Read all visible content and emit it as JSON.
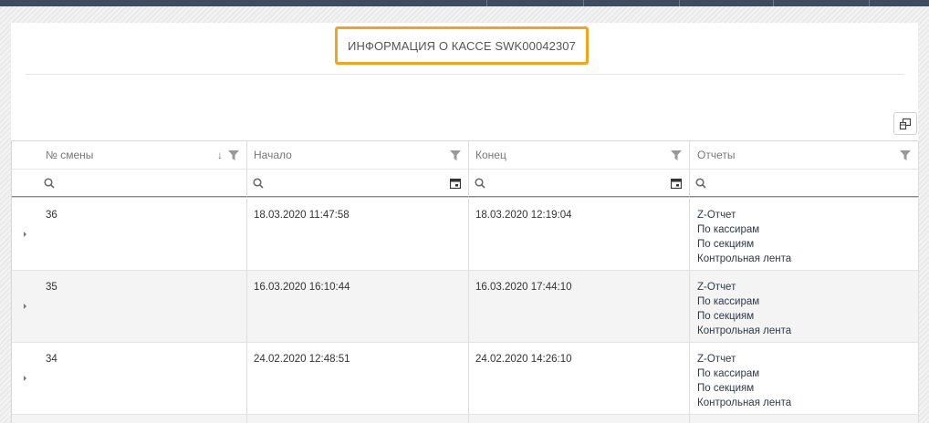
{
  "title": "ИНФОРМАЦИЯ О КАССЕ SWK00042307",
  "accent_color": "#f7a21b",
  "icons": {
    "column_chooser": "column-chooser-icon",
    "filter": "funnel-icon",
    "search": "search-icon",
    "calendar": "calendar-icon",
    "sort": "sort-descending-icon",
    "expand": "expand-arrow-icon"
  },
  "columns": [
    {
      "label": "№ смены",
      "sort": "↓"
    },
    {
      "label": "Начало"
    },
    {
      "label": "Конец"
    },
    {
      "label": "Отчеты"
    }
  ],
  "rows": [
    {
      "shift": "36",
      "start": "18.03.2020 11:47:58",
      "end": "18.03.2020 12:19:04",
      "reports": [
        "Z-Отчет",
        "По кассирам",
        "По секциям",
        "Контрольная лента"
      ]
    },
    {
      "shift": "35",
      "start": "16.03.2020 16:10:44",
      "end": "16.03.2020 17:44:10",
      "reports": [
        "Z-Отчет",
        "По кассирам",
        "По секциям",
        "Контрольная лента"
      ]
    },
    {
      "shift": "34",
      "start": "24.02.2020 12:48:51",
      "end": "24.02.2020 14:26:10",
      "reports": [
        "Z-Отчет",
        "По кассирам",
        "По секциям",
        "Контрольная лента"
      ]
    }
  ]
}
